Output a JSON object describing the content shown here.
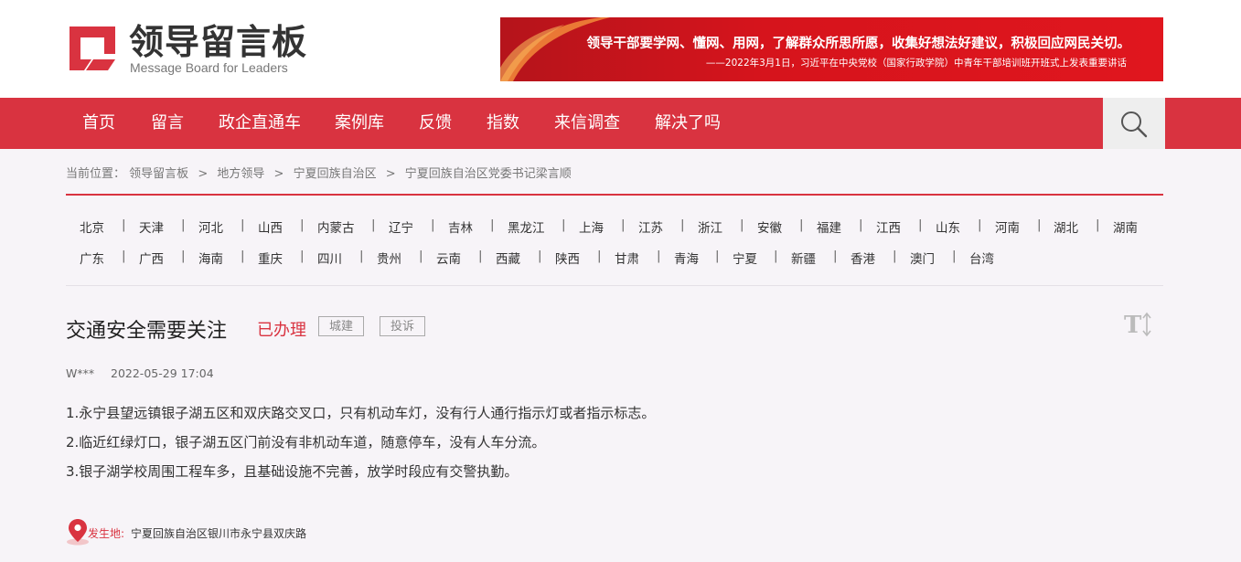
{
  "header": {
    "logo_cn": "领导留言板",
    "logo_en": "Message Board for Leaders",
    "banner_main": "领导干部要学网、懂网、用网，了解群众所思所愿，收集好想法好建议，积极回应网民关切。",
    "banner_sub": "——2022年3月1日，习近平在中央党校（国家行政学院）中青年干部培训班开班式上发表重要讲话"
  },
  "nav": {
    "items": [
      "首页",
      "留言",
      "政企直通车",
      "案例库",
      "反馈",
      "指数",
      "来信调查",
      "解决了吗"
    ],
    "search_icon": "search-icon"
  },
  "breadcrumb": {
    "prefix": "当前位置：",
    "items": [
      "领导留言板",
      "地方领导",
      "宁夏回族自治区",
      "宁夏回族自治区党委书记梁言顺"
    ],
    "separator": ">"
  },
  "regions": {
    "row1": [
      "北京",
      "天津",
      "河北",
      "山西",
      "内蒙古",
      "辽宁",
      "吉林",
      "黑龙江",
      "上海",
      "江苏",
      "浙江",
      "安徽",
      "福建",
      "江西",
      "山东",
      "河南",
      "湖北",
      "湖南"
    ],
    "row2": [
      "广东",
      "广西",
      "海南",
      "重庆",
      "四川",
      "贵州",
      "云南",
      "西藏",
      "陕西",
      "甘肃",
      "青海",
      "宁夏",
      "新疆",
      "香港",
      "澳门",
      "台湾"
    ],
    "divider": "|"
  },
  "message": {
    "title": "交通安全需要关注",
    "status": "已办理",
    "tags": [
      "城建",
      "投诉"
    ],
    "author": "W***",
    "time": "2022-05-29 17:04",
    "paragraphs": [
      "1.永宁县望远镇银子湖五区和双庆路交叉口，只有机动车灯，没有行人通行指示灯或者指示标志。",
      "2.临近红绿灯口，银子湖五区门前没有非机动车道，随意停车，没有人车分流。",
      "3.银子湖学校周围工程车多，且基础设施不完善，放学时段应有交警执勤。"
    ],
    "location_label": "发生地:",
    "location": "宁夏回族自治区银川市永宁县双庆路"
  },
  "colors": {
    "brand_red": "#d93340",
    "banner_red": "#d6141c",
    "background": "#f7f4f8"
  }
}
